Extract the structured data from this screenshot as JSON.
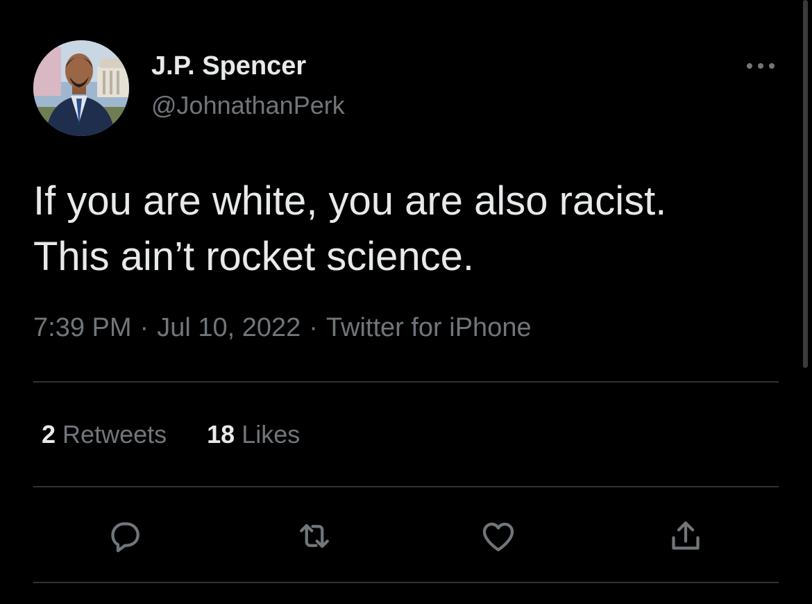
{
  "colors": {
    "background": "#000000",
    "primary_text": "#e7e9ea",
    "secondary_text": "#71767b",
    "divider": "#2f3336"
  },
  "author": {
    "display_name": "J.P. Spencer",
    "handle": "@JohnathanPerk"
  },
  "tweet": {
    "lines": [
      "If you are white, you are also racist.",
      "This ain’t rocket science."
    ]
  },
  "meta": {
    "time": "7:39 PM",
    "separator": "·",
    "date": "Jul 10, 2022",
    "source": "Twitter for iPhone"
  },
  "stats": {
    "retweets_count": "2",
    "retweets_label": "Retweets",
    "likes_count": "18",
    "likes_label": "Likes"
  },
  "icons": {
    "more": "more-horizontal-icon",
    "reply": "reply-bubble-icon",
    "retweet": "retweet-arrows-icon",
    "like": "heart-icon",
    "share": "share-upload-icon"
  }
}
